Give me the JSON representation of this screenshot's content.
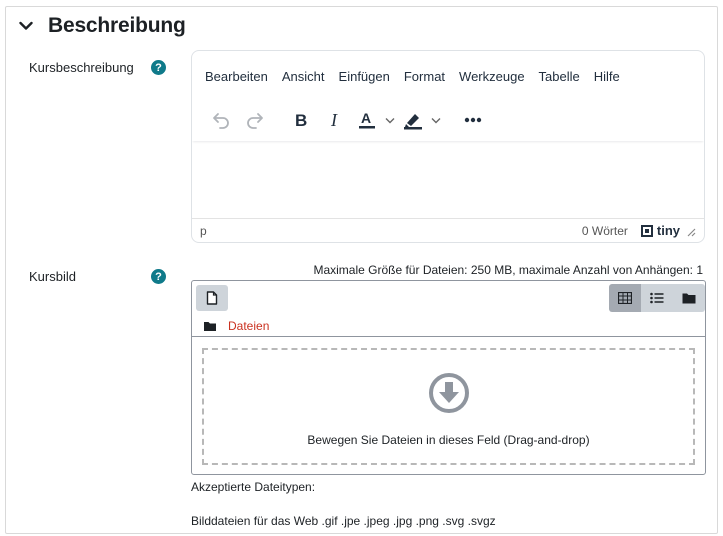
{
  "section": {
    "title": "Beschreibung",
    "icon": "chevron-down-icon"
  },
  "course_description": {
    "label": "Kursbeschreibung",
    "help_icon": "question-circle-icon"
  },
  "editor": {
    "menu": [
      "Bearbeiten",
      "Ansicht",
      "Einfügen",
      "Format",
      "Werkzeuge",
      "Tabelle",
      "Hilfe"
    ],
    "toolbar_icons": [
      "undo-icon",
      "redo-icon",
      "bold-icon",
      "italic-icon",
      "text-color-icon",
      "highlight-icon",
      "more-icon"
    ],
    "status_path": "p",
    "word_count": "0 Wörter",
    "brand": "tiny"
  },
  "course_image": {
    "label": "Kursbild",
    "help_icon": "question-circle-icon",
    "max_size_text": "Maximale Größe für Dateien: 250 MB, maximale Anzahl von Anhängen: 1",
    "path_label": "Dateien",
    "drop_text": "Bewegen Sie Dateien in dieses Feld (Drag-and-drop)",
    "accepted_title": "Akzeptierte Dateitypen:",
    "accepted_types": "Bilddateien für das Web .gif .jpe .jpeg .jpg .png .svg .svgz"
  },
  "colors": {
    "help": "#0f7a8a",
    "path_link": "#ca3120",
    "active_view": "#a4aab2"
  }
}
